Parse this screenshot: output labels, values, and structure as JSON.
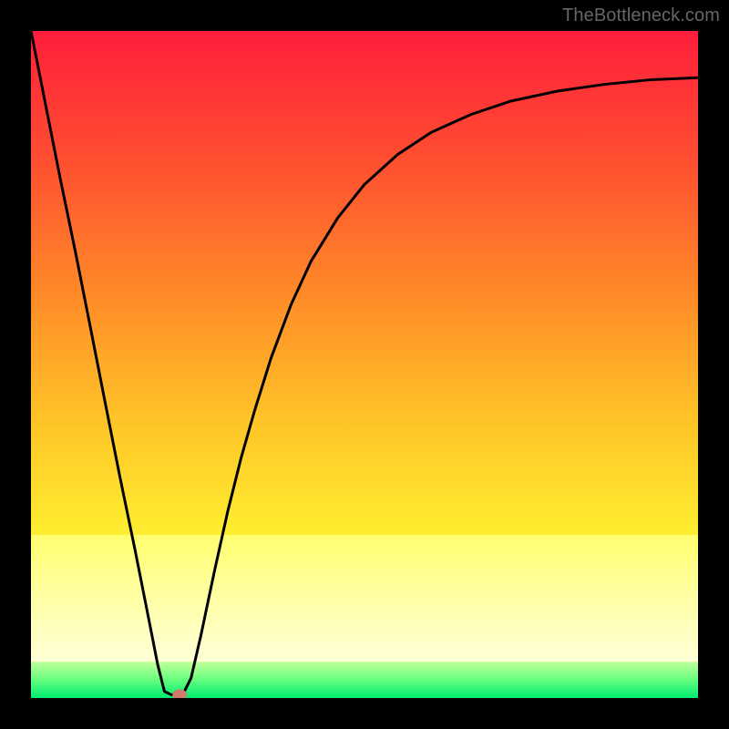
{
  "attribution": "TheBottleneck.com",
  "chart_data": {
    "type": "line",
    "title": "",
    "xlabel": "",
    "ylabel": "",
    "xlim": [
      0,
      1
    ],
    "ylim": [
      0,
      1
    ],
    "gradient_stops": [
      {
        "offset": 0.0,
        "color": "#ff1e3c"
      },
      {
        "offset": 0.2,
        "color": "#ff5030"
      },
      {
        "offset": 0.4,
        "color": "#ff8c28"
      },
      {
        "offset": 0.6,
        "color": "#ffc828"
      },
      {
        "offset": 0.755,
        "color": "#ffee30"
      },
      {
        "offset": 0.756,
        "color": "#ffff70"
      },
      {
        "offset": 0.84,
        "color": "#ffffa0"
      },
      {
        "offset": 0.945,
        "color": "#ffffd8"
      },
      {
        "offset": 0.946,
        "color": "#bfff9a"
      },
      {
        "offset": 0.97,
        "color": "#70fe80"
      },
      {
        "offset": 1.0,
        "color": "#00ed70"
      }
    ],
    "series": [
      {
        "name": "bottleneck-curve",
        "type": "line",
        "x": [
          0.0,
          0.022,
          0.044,
          0.067,
          0.089,
          0.111,
          0.133,
          0.156,
          0.178,
          0.19,
          0.2,
          0.21,
          0.22,
          0.23,
          0.24,
          0.255,
          0.275,
          0.295,
          0.315,
          0.335,
          0.36,
          0.39,
          0.42,
          0.46,
          0.5,
          0.55,
          0.6,
          0.66,
          0.72,
          0.79,
          0.86,
          0.93,
          1.0
        ],
        "y": [
          1.0,
          0.889,
          0.778,
          0.667,
          0.556,
          0.444,
          0.333,
          0.222,
          0.111,
          0.05,
          0.01,
          0.005,
          0.005,
          0.01,
          0.03,
          0.095,
          0.19,
          0.28,
          0.36,
          0.43,
          0.51,
          0.59,
          0.655,
          0.72,
          0.77,
          0.815,
          0.848,
          0.875,
          0.895,
          0.91,
          0.92,
          0.927,
          0.93
        ]
      }
    ],
    "marker": {
      "x": 0.223,
      "y": 0.005,
      "color": "#cf7b6e",
      "r": 7
    }
  }
}
